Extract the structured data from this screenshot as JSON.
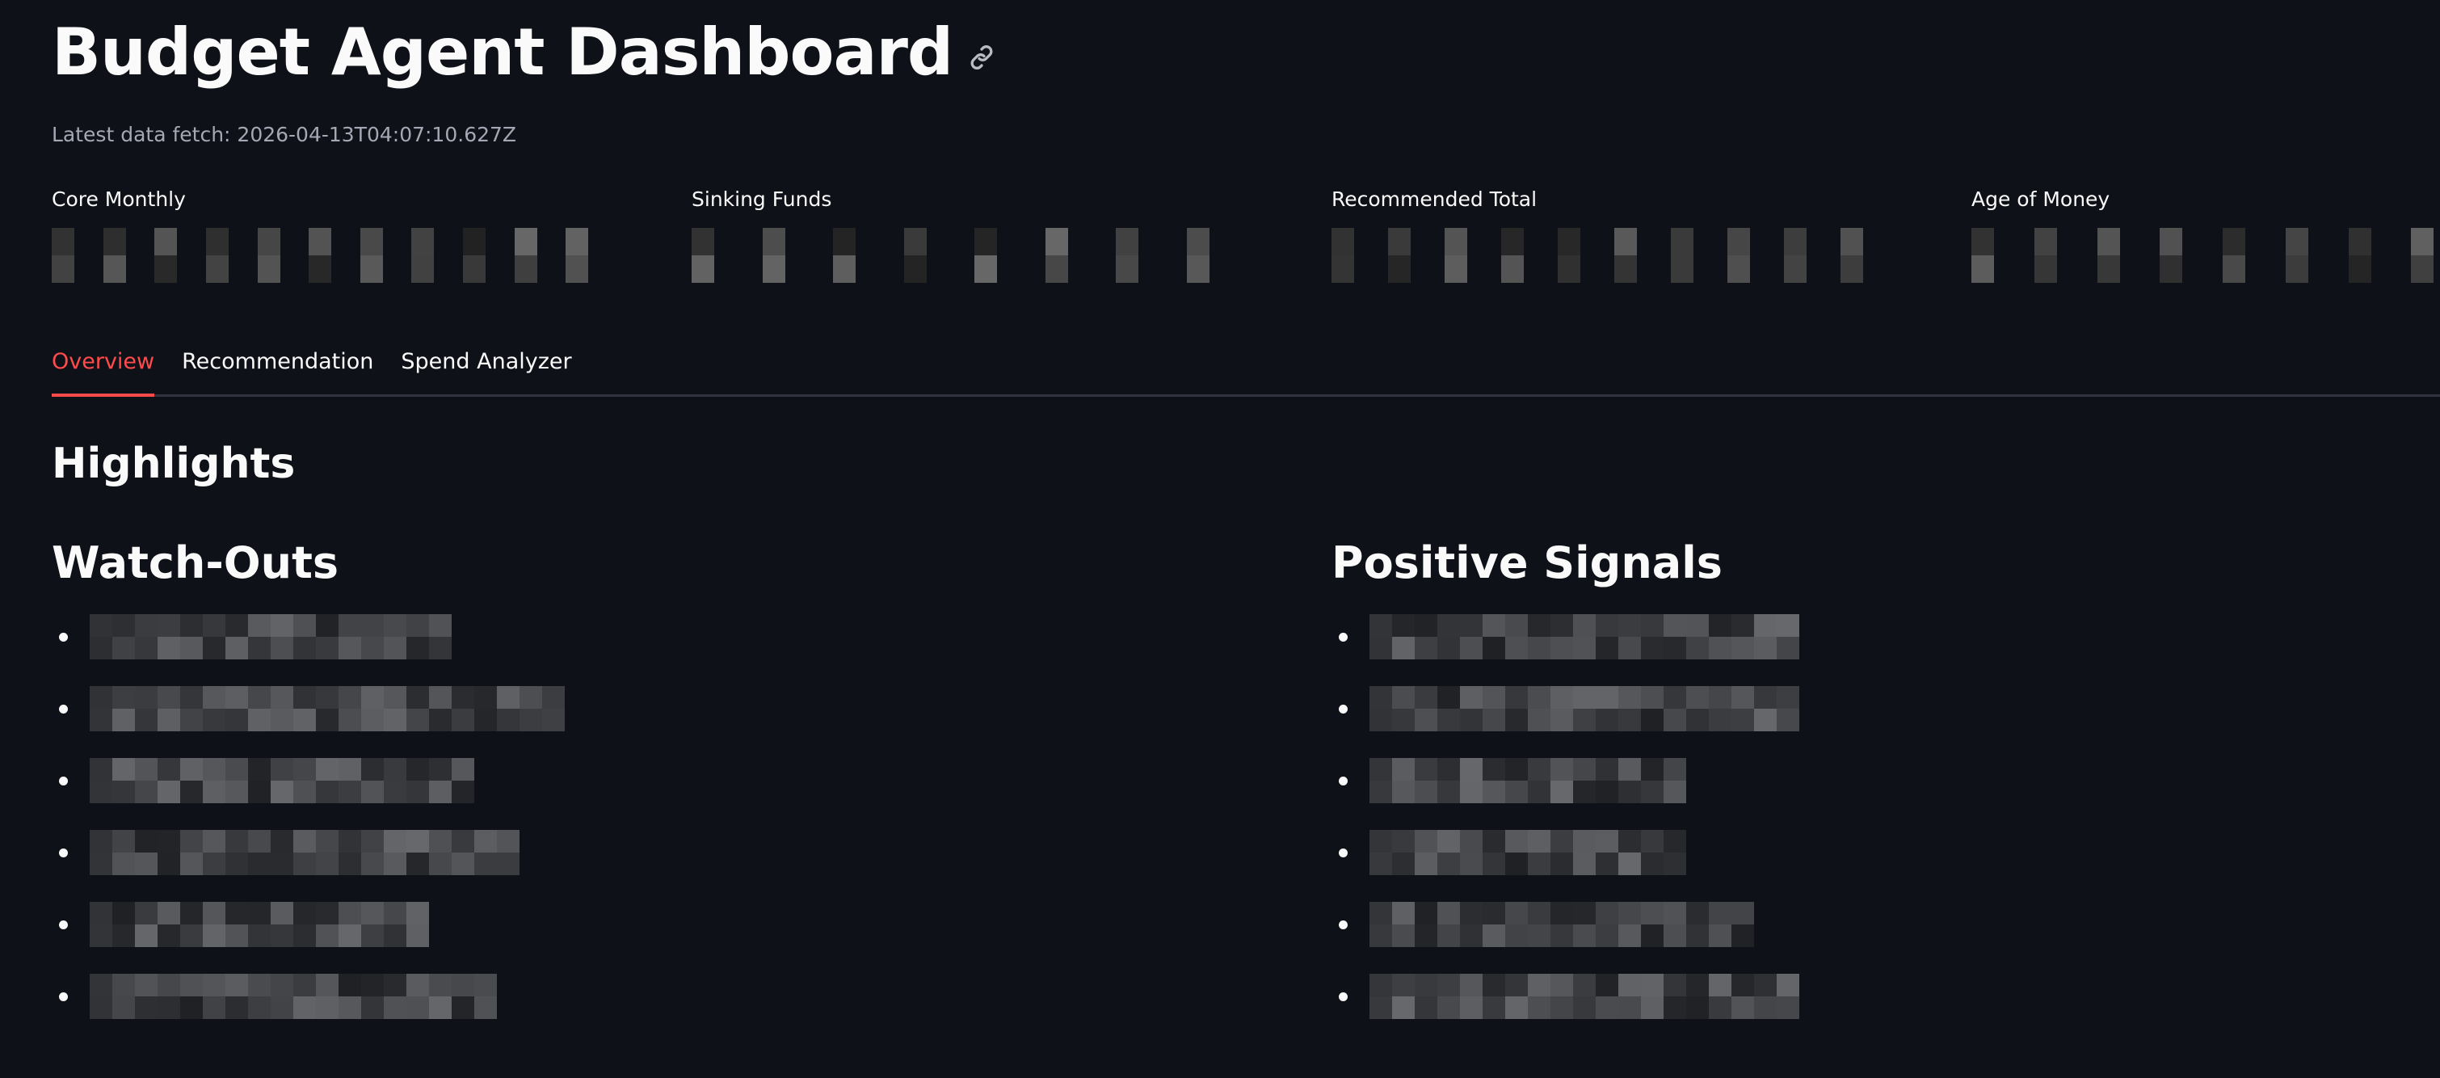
{
  "page": {
    "title": "Budget Agent Dashboard",
    "anchor_icon": "link-icon",
    "latest_fetch": "Latest data fetch: 2026-04-13T04:07:10.627Z"
  },
  "metrics": [
    {
      "label": "Core Monthly",
      "value_redacted": true
    },
    {
      "label": "Sinking Funds",
      "value_redacted": true
    },
    {
      "label": "Recommended Total",
      "value_redacted": true
    },
    {
      "label": "Age of Money",
      "value_redacted": true
    }
  ],
  "tabs": [
    {
      "label": "Overview",
      "active": true
    },
    {
      "label": "Recommendation",
      "active": false
    },
    {
      "label": "Spend Analyzer",
      "active": false
    }
  ],
  "highlights": {
    "title": "Highlights",
    "watch_outs": {
      "title": "Watch-Outs",
      "items": [
        "",
        "",
        "",
        "",
        "",
        ""
      ]
    },
    "positive_signals": {
      "title": "Positive Signals",
      "items": [
        "",
        "",
        "",
        "",
        "",
        ""
      ]
    }
  },
  "colors": {
    "background": "#0e1117",
    "text": "#fafafa",
    "muted_text": "#a3a8b4",
    "accent": "#ff4b4b",
    "divider": "#31333f"
  }
}
